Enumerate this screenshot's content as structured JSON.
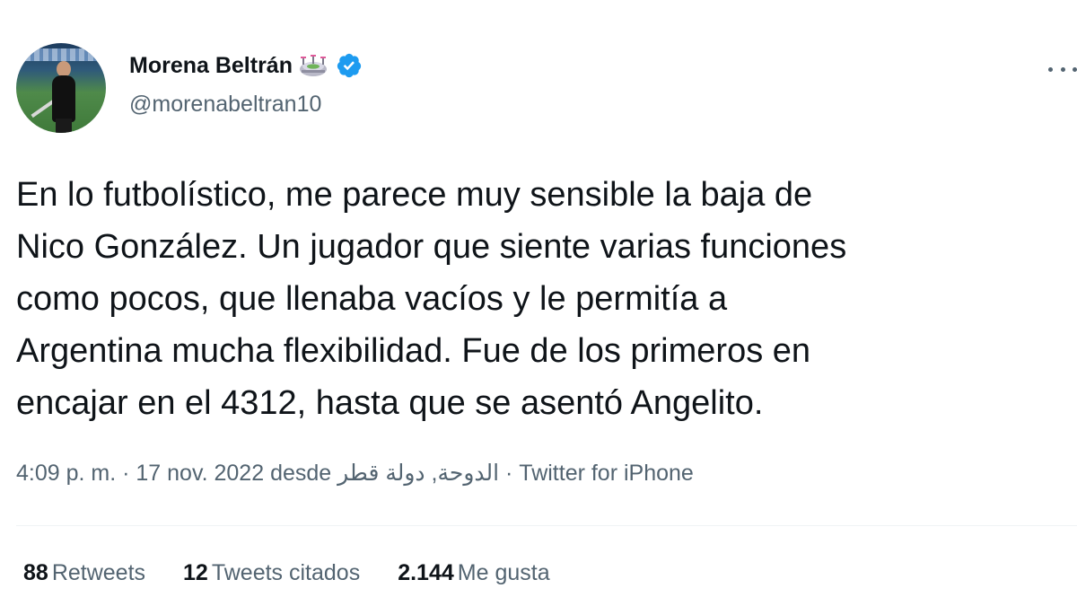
{
  "author": {
    "display_name": "Morena Beltrán",
    "handle": "@morenabeltran10",
    "avatar_icon": "profile-photo",
    "emoji_icon": "stadium-emoji",
    "verified_icon": "verified-badge-icon",
    "verified_color": "#1d9bf0"
  },
  "tweet": {
    "text": "En lo futbolístico, me parece muy sensible la baja de\nNico González. Un jugador que siente varias funciones\ncomo pocos, que llenaba vacíos y le permitía a\nArgentina mucha flexibilidad. Fue de los primeros en\nencajar en el 4312, hasta que se asentó Angelito."
  },
  "meta": {
    "time": "4:09 p. m.",
    "separator": " · ",
    "date": "17 nov. 2022",
    "from_word": "desde",
    "location": "الدوحة, دولة قطر",
    "source": "Twitter for iPhone"
  },
  "stats": {
    "retweets_count": "88",
    "retweets_label": "Retweets",
    "quotes_count": "12",
    "quotes_label": "Tweets citados",
    "likes_count": "2.144",
    "likes_label": "Me gusta"
  },
  "colors": {
    "text": "#0f1419",
    "secondary": "#536471",
    "divider": "#eff3f4",
    "accent": "#1d9bf0"
  }
}
